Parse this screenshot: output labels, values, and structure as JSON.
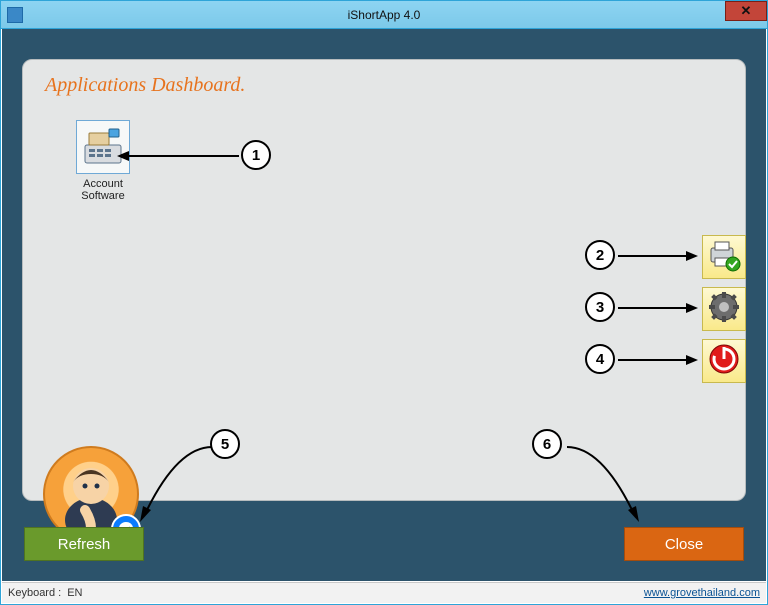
{
  "window": {
    "title": "iShortApp 4.0",
    "close_glyph": "✕"
  },
  "panel": {
    "heading": "Applications Dashboard."
  },
  "apps": [
    {
      "name": "account-software",
      "label": "Account\nSoftware",
      "icon": "cash-register-icon"
    }
  ],
  "side_buttons": [
    {
      "name": "printer-status-button",
      "icon": "printer-check-icon"
    },
    {
      "name": "settings-button",
      "icon": "gear-icon"
    },
    {
      "name": "power-button",
      "icon": "power-icon"
    }
  ],
  "avatar": {
    "name": "support-avatar",
    "badge_icon": "messenger-icon"
  },
  "buttons": {
    "refresh": "Refresh",
    "close": "Close"
  },
  "statusbar": {
    "keyboard_label": "Keyboard :",
    "keyboard_value": "EN",
    "link": "www.grovethailand.com"
  },
  "callouts": [
    "1",
    "2",
    "3",
    "4",
    "5",
    "6"
  ],
  "colors": {
    "accent_orange": "#e7731e",
    "panel_bg": "#e4e6e6",
    "frame_bg": "#2c536b",
    "refresh_btn": "#6a9a2c",
    "close_btn": "#da6612"
  }
}
